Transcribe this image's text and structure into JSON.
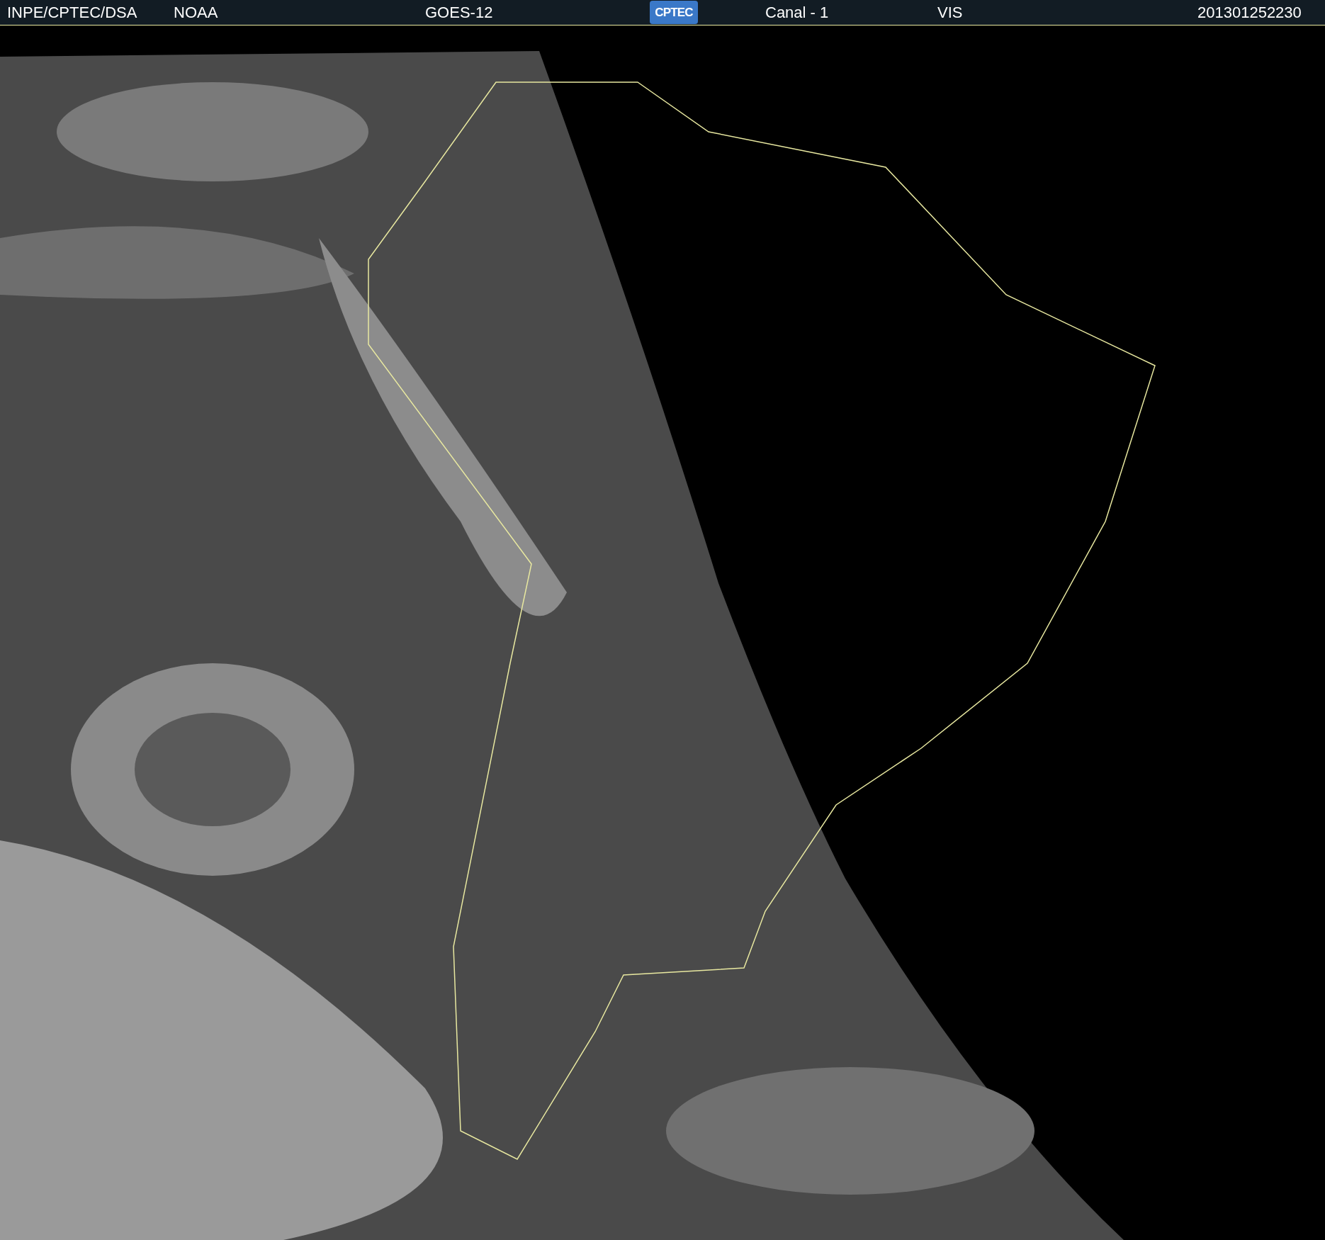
{
  "header": {
    "items": [
      {
        "kind": "text",
        "text": "INPE/CPTEC/DSA"
      },
      {
        "kind": "text",
        "text": "NOAA"
      },
      {
        "kind": "text",
        "text": "GOES-12"
      },
      {
        "kind": "logo",
        "text": "CPTEC"
      },
      {
        "kind": "text",
        "text": "Canal - 1"
      },
      {
        "kind": "text",
        "text": "VIS"
      },
      {
        "kind": "text",
        "text": "201301252230"
      }
    ]
  }
}
